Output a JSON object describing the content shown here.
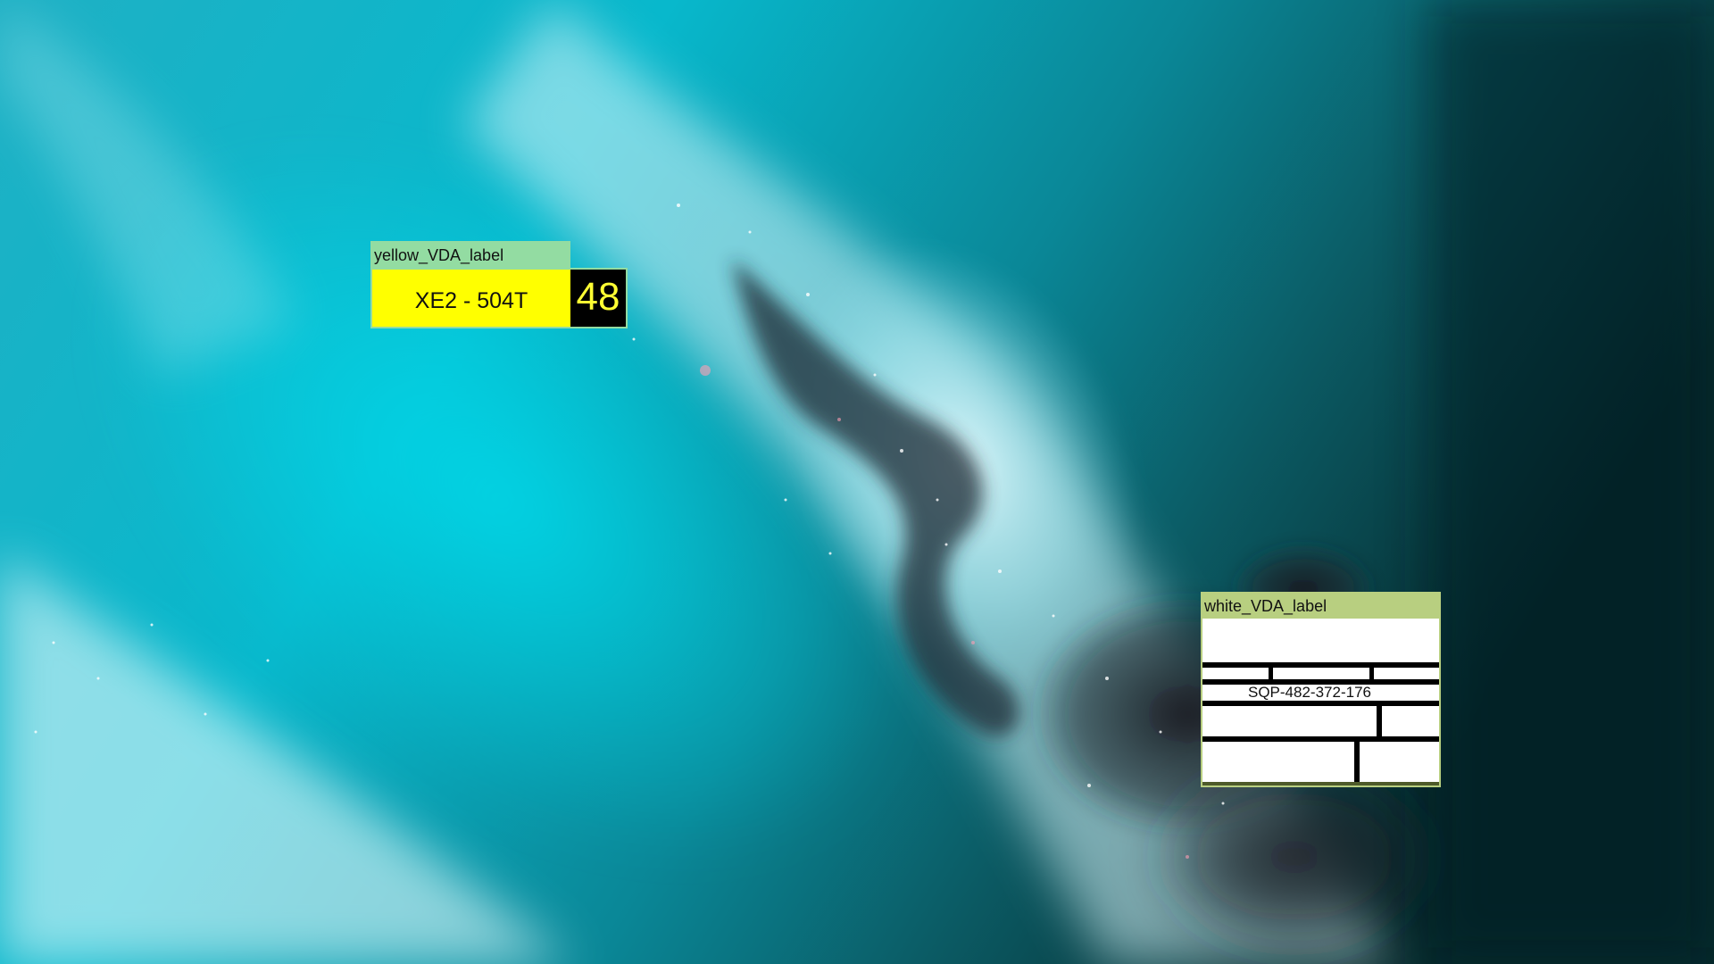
{
  "desktop": {
    "wallpaper": "abstract teal and white fluid art with dark ink swirl",
    "colors": {
      "teal_bright": "#06c9da",
      "teal_deep": "#0a6f7c",
      "dark_corner": "#072a2c",
      "ink": "#1a1d24"
    }
  },
  "yellow_label": {
    "title": "yellow_VDA_label",
    "part_code": "XE2 - 504T",
    "number": "48",
    "colors": {
      "title_bar": "#93dca2",
      "body": "#ffff00",
      "number_box": "#000000",
      "number_text": "#ffff33"
    }
  },
  "white_label": {
    "title": "white_VDA_label",
    "serial": "SQP-482-372-176",
    "colors": {
      "title_bar": "#b8cf80",
      "body": "#ffffff",
      "rules": "#000000"
    }
  }
}
